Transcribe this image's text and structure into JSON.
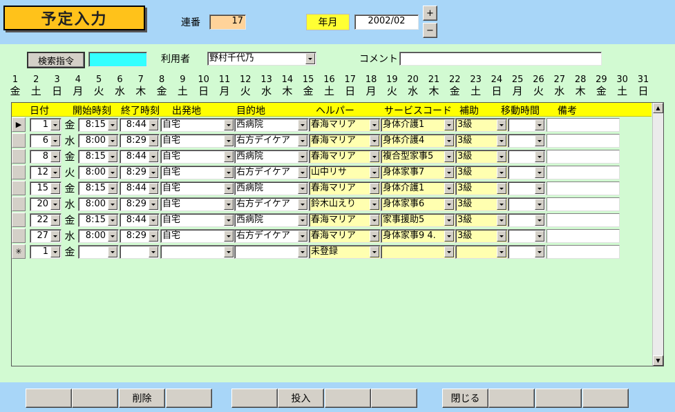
{
  "header": {
    "title": "予定入力",
    "renban_label": "連番",
    "renban_value": "17",
    "yearmonth_label": "年月",
    "yearmonth_value": "2002/02",
    "plus": "+",
    "minus": "−"
  },
  "search": {
    "button_label": "検索指令",
    "user_label": "利用者",
    "user_value": "野村千代乃",
    "comment_label": "コメント",
    "comment_value": ""
  },
  "calendar": {
    "days": [
      "1",
      "2",
      "3",
      "4",
      "5",
      "6",
      "7",
      "8",
      "9",
      "10",
      "11",
      "12",
      "13",
      "14",
      "15",
      "16",
      "17",
      "18",
      "19",
      "20",
      "21",
      "22",
      "23",
      "24",
      "25",
      "26",
      "27",
      "28",
      "29",
      "30",
      "31"
    ],
    "weekdays": [
      "金",
      "土",
      "日",
      "月",
      "火",
      "水",
      "木",
      "金",
      "土",
      "日",
      "月",
      "火",
      "水",
      "木",
      "金",
      "土",
      "日",
      "月",
      "火",
      "水",
      "木",
      "金",
      "土",
      "日",
      "月",
      "火",
      "水",
      "木",
      "金",
      "土",
      "日"
    ]
  },
  "grid": {
    "columns": [
      "日付",
      "開始時刻",
      "終了時刻",
      "出発地",
      "目的地",
      "ヘルパー",
      "サービスコード",
      "補助",
      "移動時間",
      "備考"
    ],
    "rows": [
      {
        "marker": "▶",
        "day": "1",
        "wd": "金",
        "start": "8:15",
        "end": "8:44",
        "from": "自宅",
        "to": "西病院",
        "helper": "春海マリア",
        "service": "身体介護1",
        "aux": "3級",
        "move": "",
        "note": ""
      },
      {
        "marker": "",
        "day": "6",
        "wd": "水",
        "start": "8:00",
        "end": "8:29",
        "from": "自宅",
        "to": "右方デイケア",
        "helper": "春海マリア",
        "service": "身体介護4",
        "aux": "3級",
        "move": "",
        "note": ""
      },
      {
        "marker": "",
        "day": "8",
        "wd": "金",
        "start": "8:15",
        "end": "8:44",
        "from": "自宅",
        "to": "西病院",
        "helper": "春海マリア",
        "service": "複合型家事5",
        "aux": "3級",
        "move": "",
        "note": ""
      },
      {
        "marker": "",
        "day": "12",
        "wd": "火",
        "start": "8:00",
        "end": "8:29",
        "from": "自宅",
        "to": "右方デイケア",
        "helper": "山中リサ",
        "service": "身体家事7",
        "aux": "3級",
        "move": "",
        "note": ""
      },
      {
        "marker": "",
        "day": "15",
        "wd": "金",
        "start": "8:15",
        "end": "8:44",
        "from": "自宅",
        "to": "西病院",
        "helper": "春海マリア",
        "service": "身体介護1",
        "aux": "3級",
        "move": "",
        "note": ""
      },
      {
        "marker": "",
        "day": "20",
        "wd": "水",
        "start": "8:00",
        "end": "8:29",
        "from": "自宅",
        "to": "右方デイケア",
        "helper": "鈴木山えり",
        "service": "身体家事6",
        "aux": "3級",
        "move": "",
        "note": ""
      },
      {
        "marker": "",
        "day": "22",
        "wd": "金",
        "start": "8:15",
        "end": "8:44",
        "from": "自宅",
        "to": "西病院",
        "helper": "春海マリア",
        "service": "家事援助5",
        "aux": "3級",
        "move": "",
        "note": ""
      },
      {
        "marker": "",
        "day": "27",
        "wd": "水",
        "start": "8:00",
        "end": "8:29",
        "from": "自宅",
        "to": "右方デイケア",
        "helper": "春海マリア",
        "service": "身体家事9 4.",
        "aux": "3級",
        "move": "",
        "note": ""
      },
      {
        "marker": "✳",
        "day": "1",
        "wd": "金",
        "start": "",
        "end": "",
        "from": "",
        "to": "",
        "helper": "未登録",
        "service": "",
        "aux": "",
        "move": "",
        "note": ""
      }
    ]
  },
  "footer": {
    "buttons": [
      "",
      "",
      "削除",
      "",
      "",
      "投入",
      "",
      "",
      "閉じる",
      "",
      "",
      "",
      ""
    ]
  },
  "colors": {
    "background": "#a8d6f8",
    "panel": "#d2fad2",
    "title": "#ffc21a",
    "header_yellow": "#ffff00",
    "renban_bg": "#ffd39a",
    "search_field": "#33ffff"
  }
}
